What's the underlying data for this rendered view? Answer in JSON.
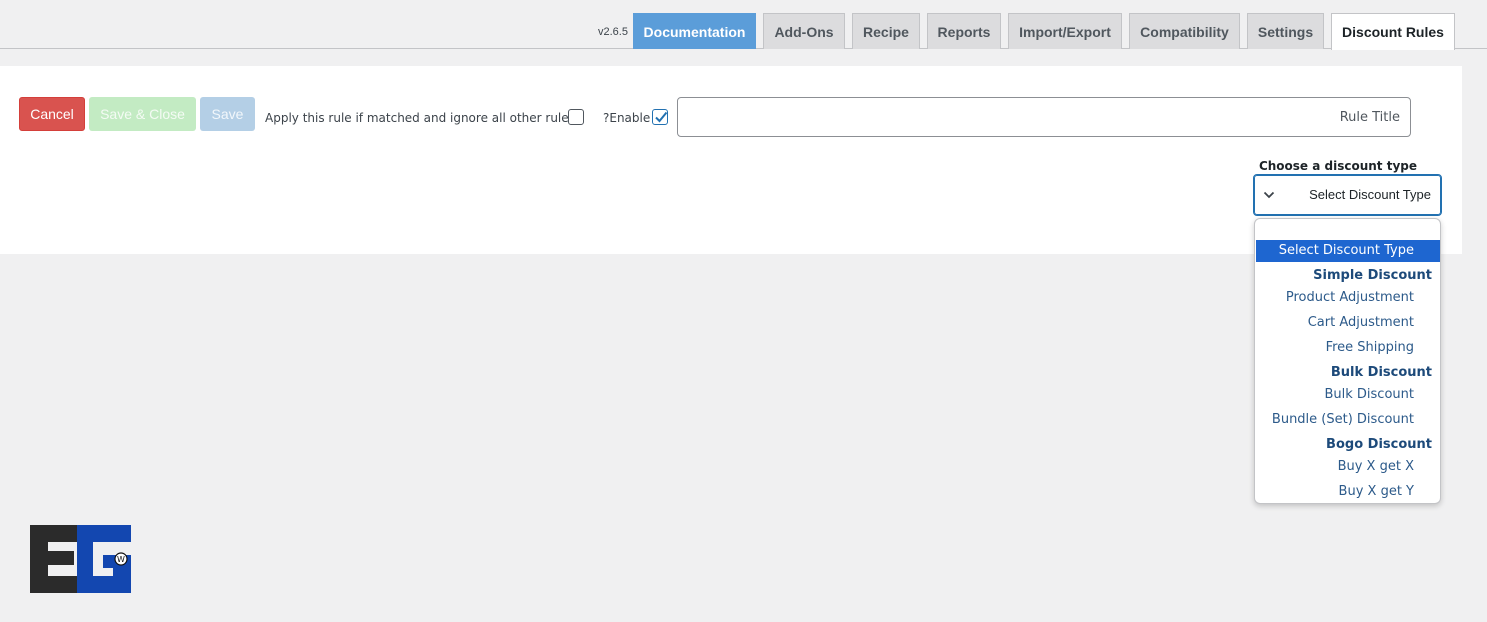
{
  "header": {
    "version": "v2.6.5",
    "tabs": [
      {
        "label": "Documentation"
      },
      {
        "label": "Add-Ons"
      },
      {
        "label": "Recipe"
      },
      {
        "label": "Reports"
      },
      {
        "label": "Import/Export"
      },
      {
        "label": "Compatibility"
      },
      {
        "label": "Settings"
      },
      {
        "label": "Discount Rules"
      }
    ],
    "active_tab": "Discount Rules"
  },
  "toolbar": {
    "cancel_label": "Cancel",
    "save_close_label": "Save & Close",
    "save_label": "Save",
    "apply_rule_label": "Apply this rule if matched and ignore all other rules",
    "apply_rule_checked": false,
    "enable_label": "?Enable",
    "enable_checked": true
  },
  "rule_title": {
    "value": "",
    "placeholder": "Rule Title"
  },
  "discount_type": {
    "label": "Choose a discount type",
    "selected": "Select Discount Type",
    "options": {
      "select": "Select Discount Type",
      "group_simple": "Simple Discount",
      "product_adjustment": "Product Adjustment",
      "cart_adjustment": "Cart Adjustment",
      "free_shipping": "Free Shipping",
      "group_bulk": "Bulk Discount",
      "bulk_discount": "Bulk Discount",
      "bundle_discount": "Bundle (Set) Discount",
      "group_bogo": "Bogo Discount",
      "buy_x_get_x": "Buy X get X",
      "buy_x_get_y": "Buy X get Y"
    }
  },
  "colors": {
    "cancel": "#d9534f",
    "save_close": "#c3ebc3",
    "save": "#b4cfe6",
    "documentation_tab": "#5b9dd9",
    "dropdown_selected": "#1e66d0",
    "logo_dark": "#2b2b2b",
    "logo_blue": "#1347b0"
  },
  "logo": {
    "icon": "eg-logo-icon"
  }
}
